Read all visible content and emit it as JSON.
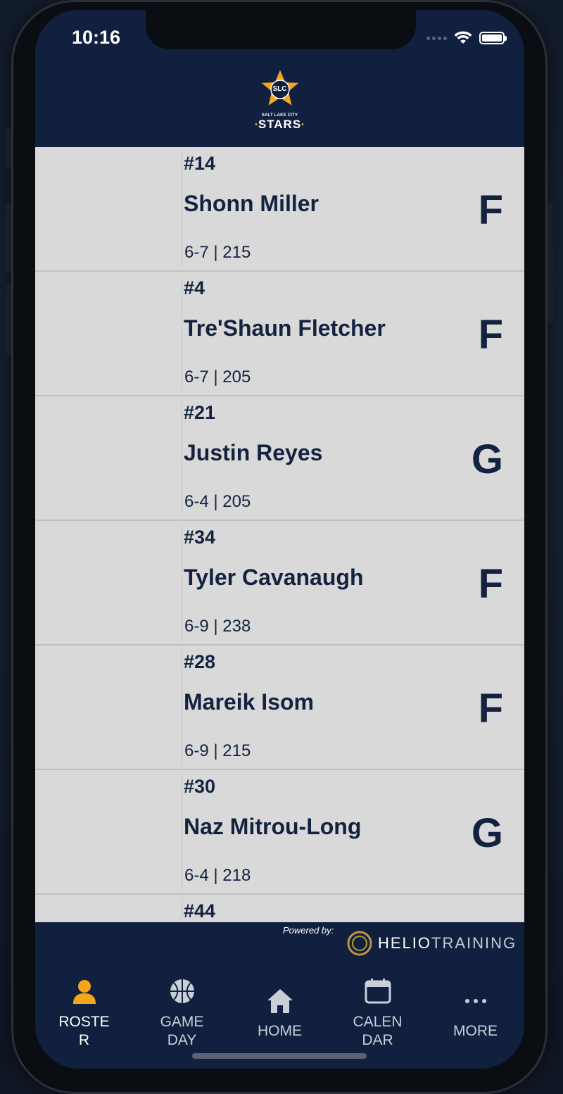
{
  "status_bar": {
    "time": "10:16"
  },
  "header": {
    "logo_badge": "SLC",
    "logo_line1": "SALT LAKE CITY",
    "logo_line2": "STARS"
  },
  "roster": [
    {
      "number": "#14",
      "name": "Shonn Miller",
      "stats": "6-7 | 215",
      "position": "F"
    },
    {
      "number": "#4",
      "name": "Tre'Shaun Fletcher",
      "stats": "6-7 | 205",
      "position": "F"
    },
    {
      "number": "#21",
      "name": "Justin Reyes",
      "stats": "6-4 | 205",
      "position": "G"
    },
    {
      "number": "#34",
      "name": "Tyler Cavanaugh",
      "stats": "6-9 | 238",
      "position": "F"
    },
    {
      "number": "#28",
      "name": "Mareik Isom",
      "stats": "6-9 | 215",
      "position": "F"
    },
    {
      "number": "#30",
      "name": "Naz Mitrou-Long",
      "stats": "6-4 | 218",
      "position": "G"
    },
    {
      "number": "#44",
      "name": "",
      "stats": "",
      "position": ""
    }
  ],
  "footer": {
    "powered_by": "Powered by:",
    "brand_bold": "HELIO",
    "brand_thin": "TRAINING"
  },
  "tabs": [
    {
      "label_line1": "ROSTE",
      "label_line2": "R",
      "icon": "person-icon",
      "active": true
    },
    {
      "label_line1": "GAME",
      "label_line2": "DAY",
      "icon": "basketball-icon",
      "active": false
    },
    {
      "label_line1": "HOME",
      "label_line2": "",
      "icon": "home-icon",
      "active": false
    },
    {
      "label_line1": "CALEN",
      "label_line2": "DAR",
      "icon": "calendar-icon",
      "active": false
    },
    {
      "label_line1": "MORE",
      "label_line2": "",
      "icon": "more-icon",
      "active": false
    }
  ],
  "colors": {
    "navy": "#11203f",
    "text_navy": "#13233f",
    "list_bg": "#d9d9da",
    "gold": "#f4a71d"
  }
}
